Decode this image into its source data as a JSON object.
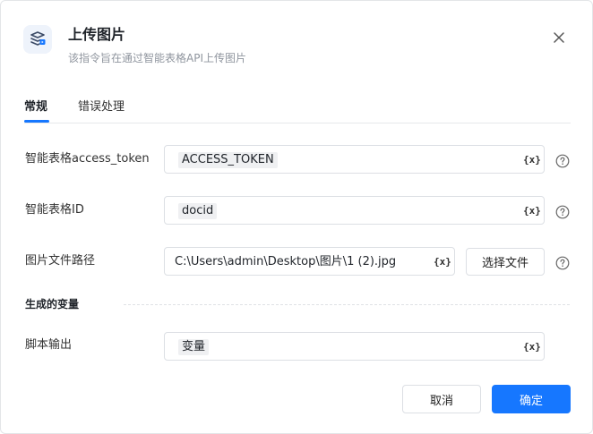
{
  "dialog": {
    "title": "上传图片",
    "subtitle": "该指令旨在通过智能表格API上传图片",
    "icon": "upload-image-icon"
  },
  "tabs": [
    {
      "label": "常规",
      "active": true
    },
    {
      "label": "错误处理",
      "active": false
    }
  ],
  "form": {
    "access_token": {
      "label": "智能表格access_token",
      "value": "ACCESS_TOKEN"
    },
    "sheet_id": {
      "label": "智能表格ID",
      "value": "docid"
    },
    "image_path": {
      "label": "图片文件路径",
      "value": "C:\\Users\\admin\\Desktop\\图片\\1 (2).jpg",
      "choose_label": "选择文件"
    },
    "variable_button": "{x}"
  },
  "output": {
    "section_title": "生成的变量",
    "script_output": {
      "label": "脚本输出",
      "value": "变量"
    }
  },
  "footer": {
    "cancel_label": "取消",
    "ok_label": "确定"
  },
  "colors": {
    "primary": "#1677ff",
    "border": "#dcdfe4",
    "chip_bg": "#eff0f2"
  }
}
